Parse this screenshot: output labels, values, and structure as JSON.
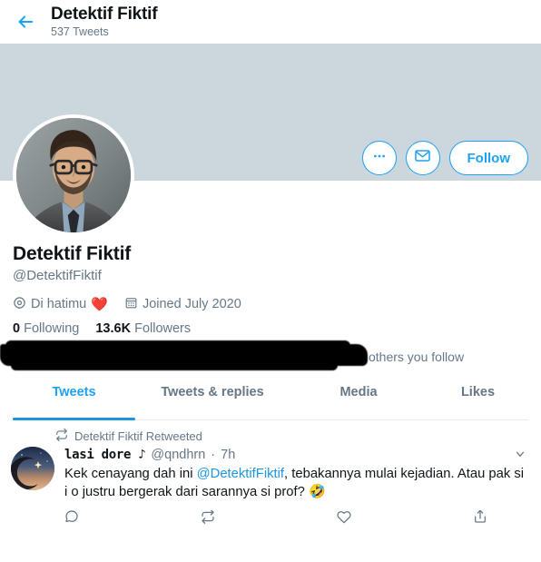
{
  "topbar": {
    "back_icon": "back-arrow-icon",
    "title": "Detektif Fiktif",
    "tweet_count": "537 Tweets"
  },
  "profile": {
    "banner_color": "#ccd6dd",
    "avatar_icon": "profile-avatar-photo",
    "display_name": "Detektif Fiktif",
    "handle": "@DetektifFiktif",
    "location_icon": "location-pin-icon",
    "location": "Di hatimu",
    "location_emoji": "❤️",
    "calendar_icon": "calendar-icon",
    "joined": "Joined July 2020",
    "following_count": "0",
    "following_label": "Following",
    "followers_count": "13.6K",
    "followers_label": "Followers",
    "followed_by_text": "others you follow"
  },
  "actions": {
    "more_icon": "more-options-icon",
    "message_icon": "envelope-icon",
    "follow_label": "Follow",
    "accent_color": "#1da1f2"
  },
  "tabs": {
    "items": [
      {
        "label": "Tweets",
        "active": true
      },
      {
        "label": "Tweets & replies",
        "active": false
      },
      {
        "label": "Media",
        "active": false
      },
      {
        "label": "Likes",
        "active": false
      }
    ]
  },
  "tweet": {
    "retweet_icon": "retweet-icon",
    "retweeted_by": "Detektif Fiktif Retweeted",
    "avatar_icon": "crescent-moon-avatar",
    "author": "lasi dore ♪",
    "handle": "@qndhrn",
    "separator": "·",
    "time": "7h",
    "caret_icon": "chevron-down-icon",
    "text_part1": "Kek cenayang dah ini ",
    "mention": "@DetektifFiktif",
    "text_part2": ", tebakannya mulai kejadian. Atau pak si i o justru bergerak dari sarannya si prof? ",
    "text_emoji": "🤣",
    "reply_icon": "reply-icon",
    "retweet_action_icon": "retweet-action-icon",
    "like_icon": "like-heart-icon",
    "share_icon": "share-icon"
  }
}
